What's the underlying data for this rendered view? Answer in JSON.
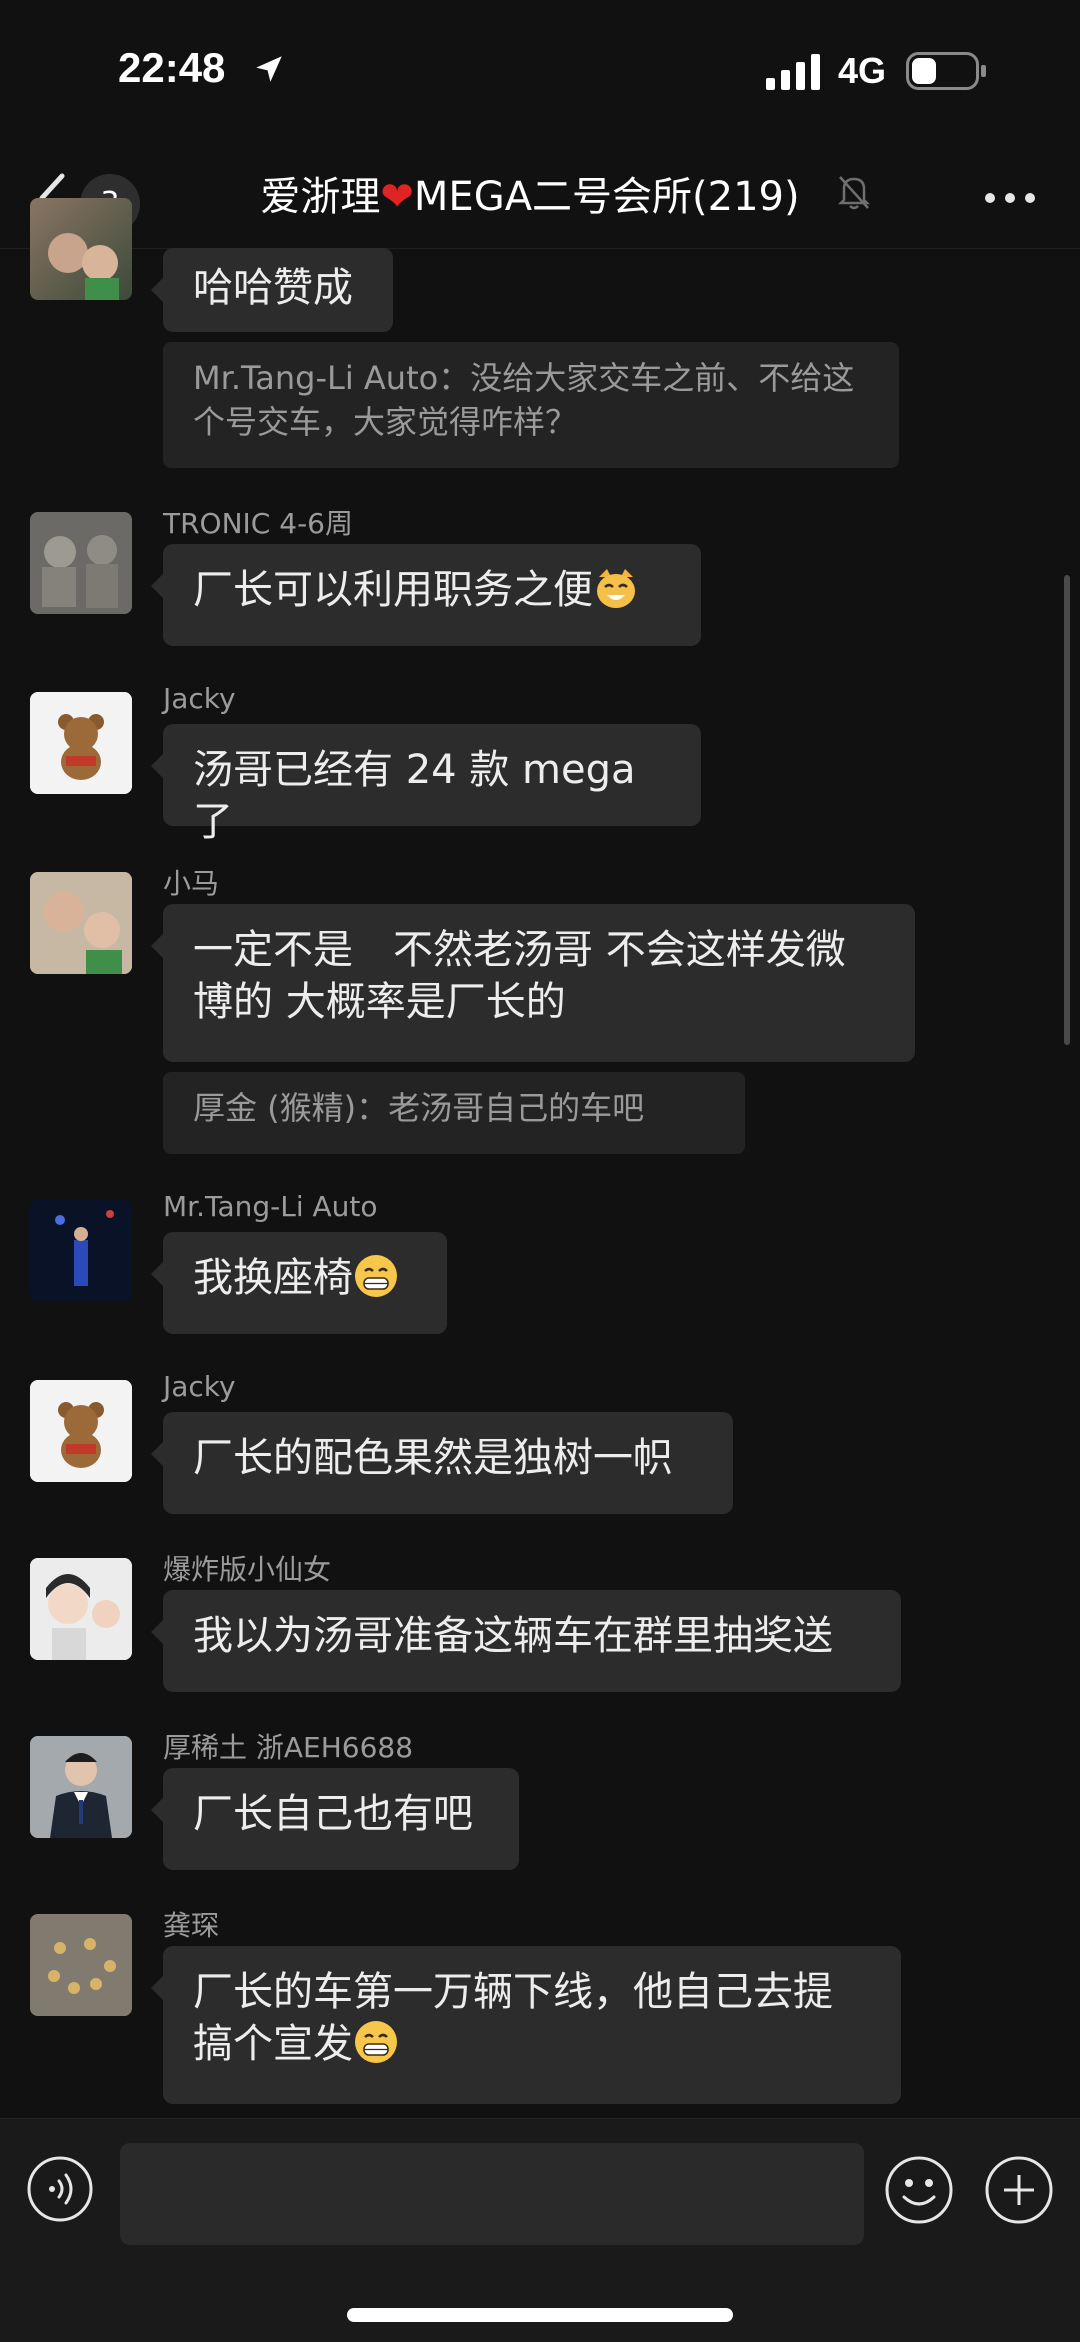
{
  "status_bar": {
    "time": "22:48",
    "network": "4G"
  },
  "nav": {
    "unread_count": "3",
    "title_prefix": "爱浙理",
    "title_suffix": "MEGA二号会所(219)"
  },
  "messages": [
    {
      "sender": "",
      "text": "哈哈赞成"
    },
    {
      "quote": "Mr.Tang-Li Auto：没给大家交车之前、不给这个号交车，大家觉得咋样？"
    },
    {
      "sender": "TRONIC 4-6周",
      "text": "厂长可以利用职务之便"
    },
    {
      "sender": "Jacky",
      "text": "汤哥已经有 24 款 mega 了"
    },
    {
      "sender": "小马",
      "text": "一定不是　不然老汤哥 不会这样发微博的  大概率是厂长的"
    },
    {
      "quote": "厚金 (猴精)：老汤哥自己的车吧"
    },
    {
      "sender": "Mr.Tang-Li Auto",
      "text": "我换座椅"
    },
    {
      "sender": "Jacky",
      "text": "厂长的配色果然是独树一帜"
    },
    {
      "sender": "爆炸版小仙女",
      "text": "我以为汤哥准备这辆车在群里抽奖送"
    },
    {
      "sender": "厚稀土 浙AEH6688",
      "text": "厂长自己也有吧"
    },
    {
      "sender": "龚琛",
      "text": "厂长的车第一万辆下线，他自己去提搞个宣发"
    }
  ],
  "icons": {
    "back": "chevron-left-icon",
    "mute": "bell-mute-icon",
    "more": "more-icon",
    "voice": "voice-icon",
    "emoji": "smile-icon",
    "plus": "plus-icon"
  }
}
